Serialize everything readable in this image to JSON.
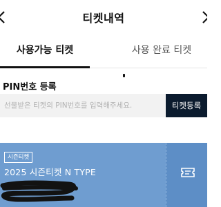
{
  "header": {
    "title": "티켓내역",
    "back_icon": "chevron-left-icon",
    "right_icon": "chevron-right-icon"
  },
  "tabs": [
    {
      "label": "사용가능 티켓",
      "active": true
    },
    {
      "label": "사용 완료 티켓",
      "active": false
    }
  ],
  "pin": {
    "label": "PIN번호 등록",
    "placeholder": "선물받은 티켓의 PIN번호를 입력해주세요.",
    "value": "",
    "button_label": "티켓등록"
  },
  "ticket": {
    "badge": "시즌티켓",
    "name": "2025 시즌티켓 N TYPE",
    "icon": "ticket-icon",
    "card_color": "#6f9dd0"
  }
}
